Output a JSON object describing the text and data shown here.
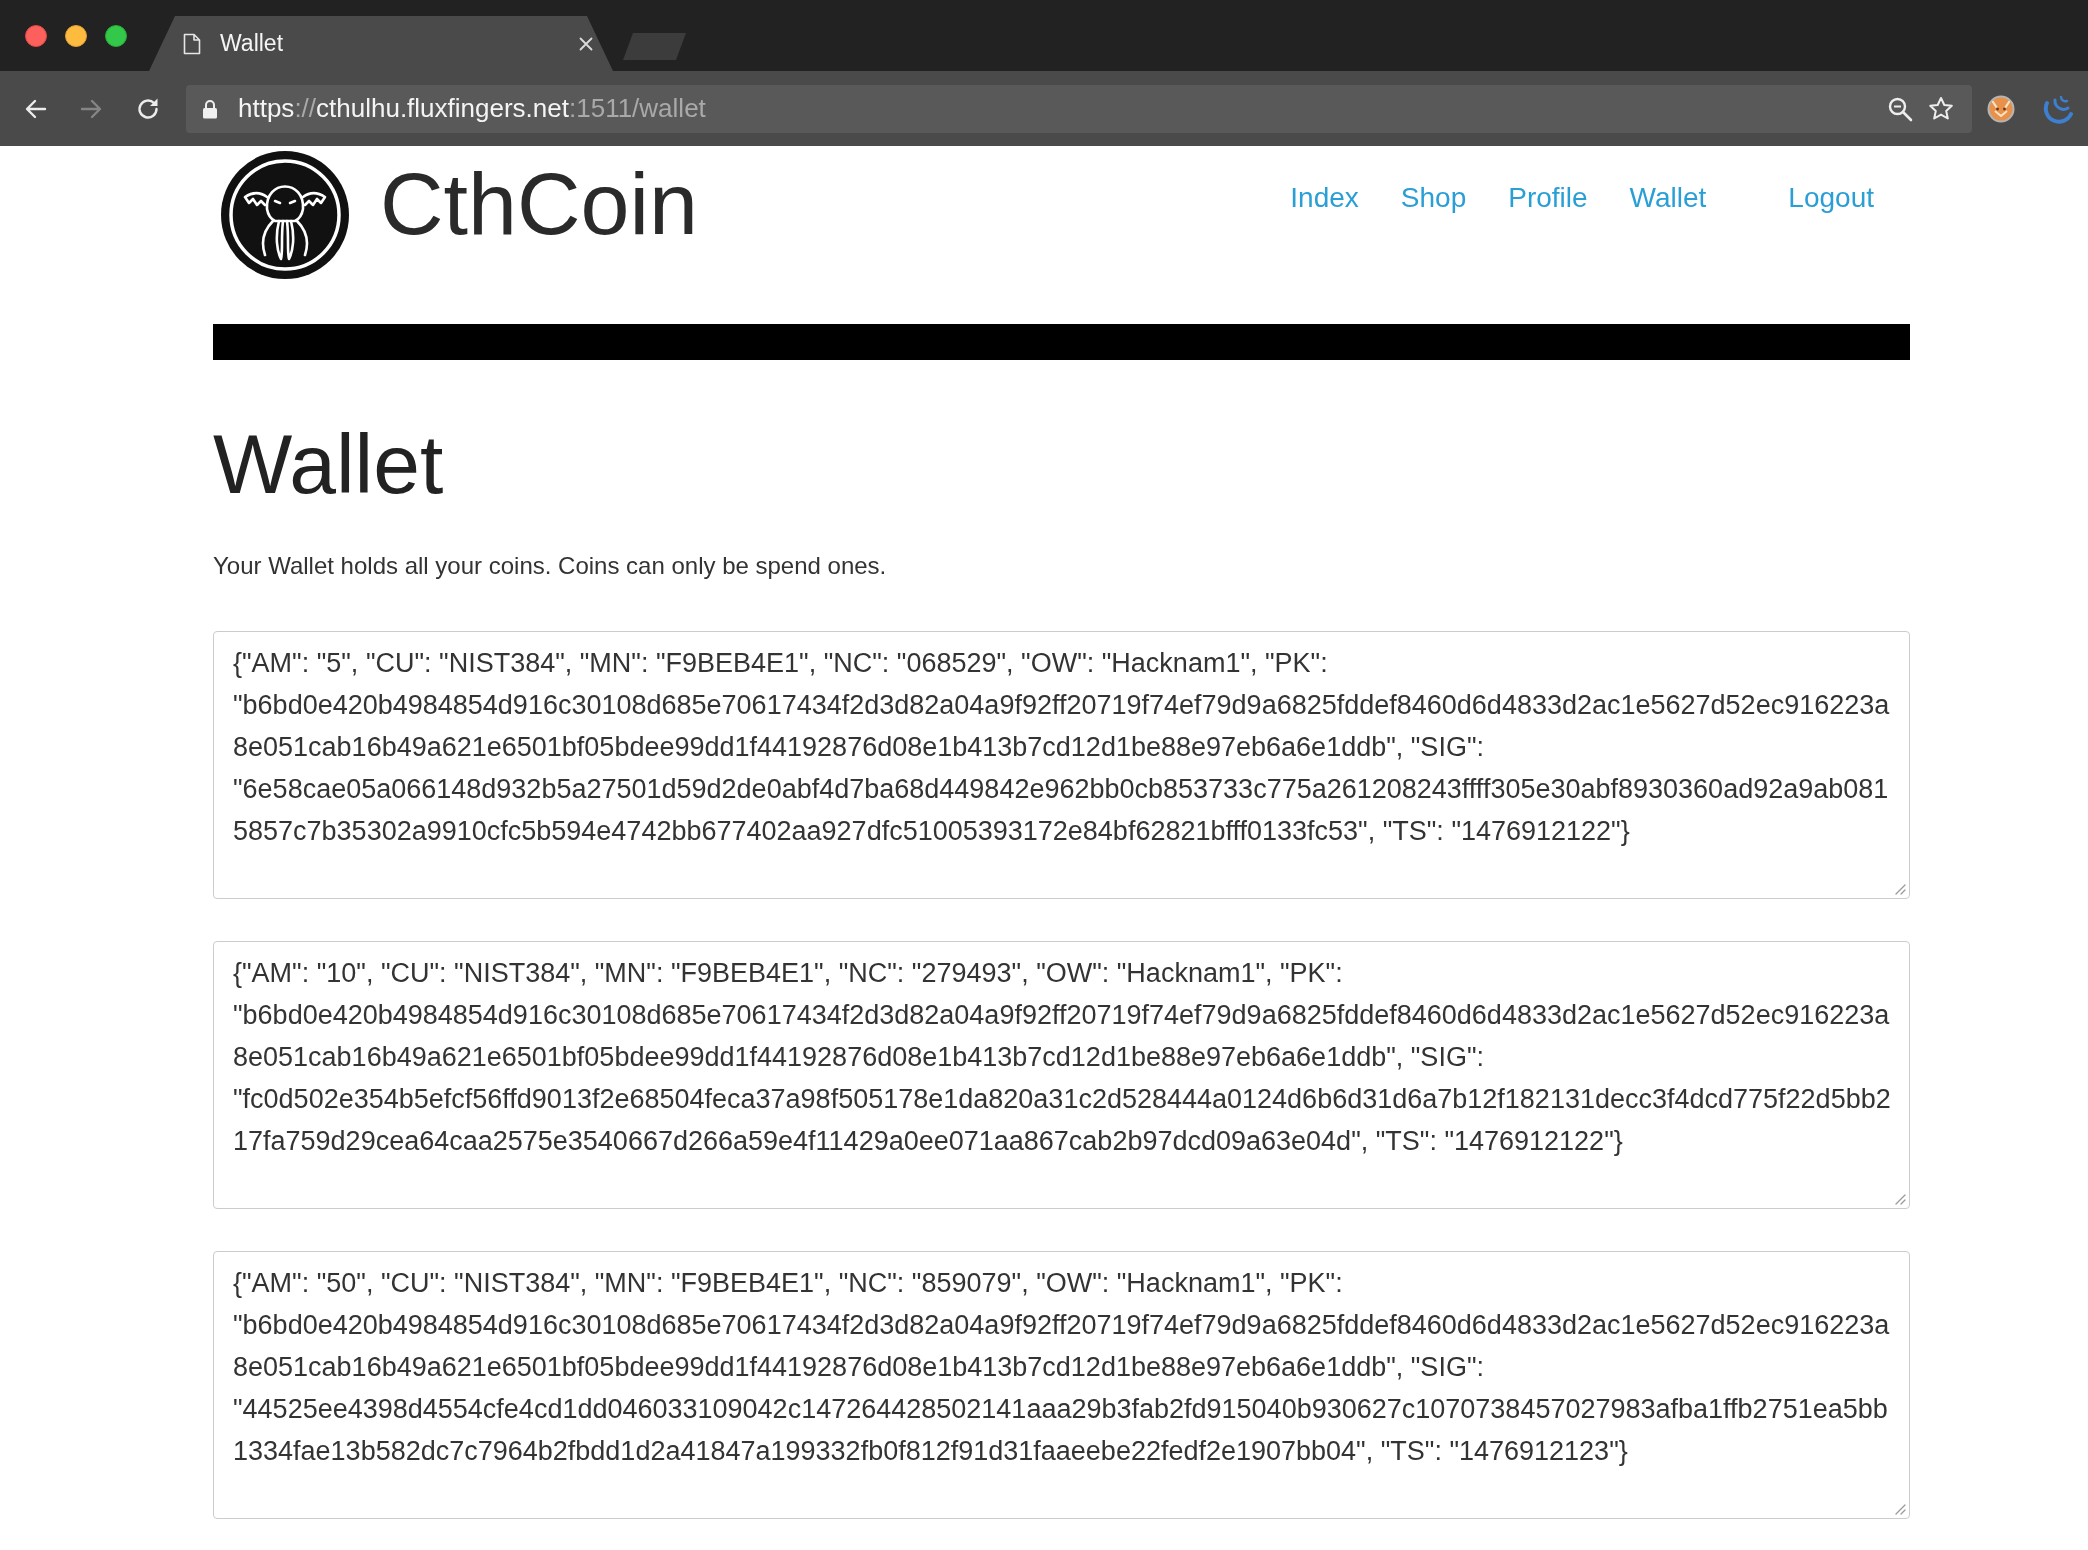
{
  "browser": {
    "tabs": [
      {
        "title": "Wallet",
        "selected": true
      }
    ],
    "toolbar": [
      {
        "kind": "back",
        "disabled": false
      },
      {
        "kind": "forward",
        "disabled": true
      },
      {
        "kind": "reload",
        "disabled": false
      }
    ],
    "address_bar": {
      "url_parts": [
        {
          "text": "https",
          "emphasized": true
        },
        {
          "text": "://",
          "emphasized": false
        },
        {
          "text": "cthulhu.fluxfingers.net",
          "emphasized": true
        },
        {
          "text": ":1511/wallet",
          "emphasized": false
        }
      ]
    }
  },
  "site": {
    "name": "CthCoin",
    "nav": [
      "Index",
      "Shop",
      "Profile",
      "Wallet"
    ],
    "logout": "Logout"
  },
  "page": {
    "title": "Wallet",
    "intro": "Your Wallet holds all your coins. Coins can only be spend ones.",
    "coins": [
      "{\"AM\": \"5\", \"CU\": \"NIST384\", \"MN\": \"F9BEB4E1\", \"NC\": \"068529\", \"OW\": \"Hacknam1\", \"PK\": \"b6bd0e420b4984854d916c30108d685e70617434f2d3d82a04a9f92ff20719f74ef79d9a6825fddef8460d6d4833d2ac1e5627d52ec916223a8e051cab16b49a621e6501bf05bdee99dd1f44192876d08e1b413b7cd12d1be88e97eb6a6e1ddb\", \"SIG\": \"6e58cae05a066148d932b5a27501d59d2de0abf4d7ba68d449842e962bb0cb853733c775a261208243ffff305e30abf8930360ad92a9ab0815857c7b35302a9910cfc5b594e4742bb677402aa927dfc51005393172e84bf62821bfff0133fc53\", \"TS\": \"1476912122\"}",
      "{\"AM\": \"10\", \"CU\": \"NIST384\", \"MN\": \"F9BEB4E1\", \"NC\": \"279493\", \"OW\": \"Hacknam1\", \"PK\": \"b6bd0e420b4984854d916c30108d685e70617434f2d3d82a04a9f92ff20719f74ef79d9a6825fddef8460d6d4833d2ac1e5627d52ec916223a8e051cab16b49a621e6501bf05bdee99dd1f44192876d08e1b413b7cd12d1be88e97eb6a6e1ddb\", \"SIG\": \"fc0d502e354b5efcf56ffd9013f2e68504feca37a98f505178e1da820a31c2d528444a0124d6b6d31d6a7b12f182131decc3f4dcd775f22d5bb217fa759d29cea64caa2575e3540667d266a59e4f11429a0ee071aa867cab2b97dcd09a63e04d\", \"TS\": \"1476912122\"}",
      "{\"AM\": \"50\", \"CU\": \"NIST384\", \"MN\": \"F9BEB4E1\", \"NC\": \"859079\", \"OW\": \"Hacknam1\", \"PK\": \"b6bd0e420b4984854d916c30108d685e70617434f2d3d82a04a9f92ff20719f74ef79d9a6825fddef8460d6d4833d2ac1e5627d52ec916223a8e051cab16b49a621e6501bf05bdee99dd1f44192876d08e1b413b7cd12d1be88e97eb6a6e1ddb\", \"SIG\": \"44525ee4398d4554cfe4cd1dd046033109042c147264428502141aaa29b3fab2fd915040b930627c1070738457027983afba1ffb2751ea5bb1334fae13b582dc7c7964b2fbdd1d2a41847a199332fb0f812f91d31faaeebe22fedf2e1907bb04\", \"TS\": \"1476912123\"}"
    ]
  }
}
